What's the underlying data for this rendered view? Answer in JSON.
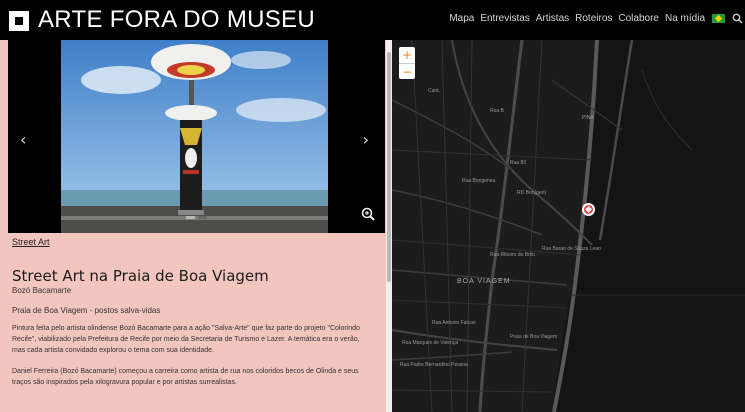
{
  "header": {
    "site_title": "ARTE FORA DO MUSEU",
    "nav": [
      "Mapa",
      "Entrevistas",
      "Artistas",
      "Roteiros",
      "Colabore",
      "Na mídia"
    ]
  },
  "carousel": {
    "prev_label": "‹",
    "next_label": "›"
  },
  "article": {
    "category": "Street Art",
    "title": "Street Art na Praia de Boa Viagem",
    "artist": "Bozó Bacamarte",
    "location": "Praia de Boa Viagem - postos salva-vidas",
    "paragraph1": "Pintura feita pelo artista olindense Bozó Bacamarte para a ação \"Salva-Arte\" que faz parte do projeto \"Colorindo Recife\", viabilizado pela Prefeitura de Recife por meio da Secretaria de Turismo e Lazer. A temática era o verão, mas cada artista convidado explorou o tema com sua identidade.",
    "paragraph2": "Daniel Ferreira (Bozó Bacamarte) começou a carreira como artista de rua nos coloridos becos de Olinda e seus traços são inspirados pela xilogravura popular e por artistas surrealistas."
  },
  "map": {
    "zoom_in": "+",
    "zoom_out": "−",
    "labels": {
      "a": "Cant.",
      "b": "Rua B",
      "c": "Rua 80",
      "d": "Rua Bongenea",
      "e": "RD Bon(gen)",
      "f": "Rua Barao de Souza Leao",
      "g": "BOA VIAGEM",
      "h": "Rua Ribeiro de Brito",
      "i": "Rua Antonio Falcao",
      "j": "Rua Marques de Valença",
      "k": "Praia de Boa Viagem",
      "l": "Rua Padre Bernardino Pessoa",
      "m": "PINA"
    }
  },
  "colors": {
    "left_panel_bg": "#f3c5bf",
    "map_bg": "#1c1c1c",
    "pin": "#e8343a",
    "zoom_accent": "#e28a1a"
  }
}
